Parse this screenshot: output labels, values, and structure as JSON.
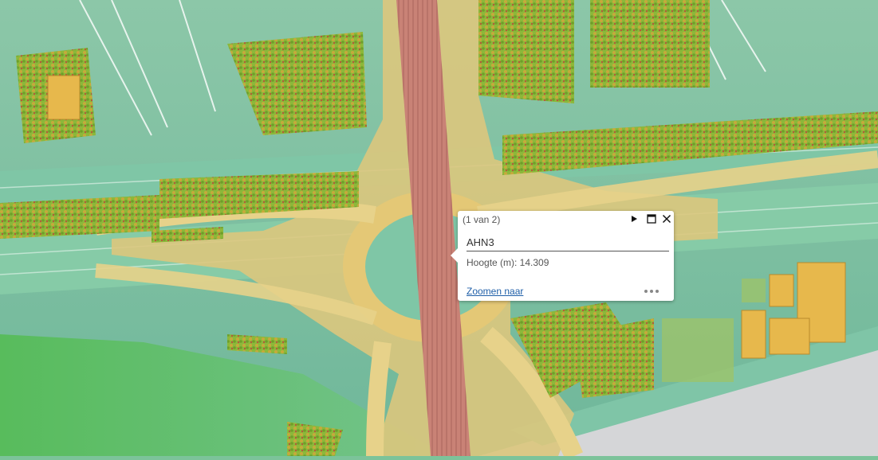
{
  "popup": {
    "pager": "(1 van 2)",
    "title": "AHN3",
    "attribute_label": "Hoogte (m):",
    "attribute_value": "14.309",
    "attribute_line": "Hoogte (m): 14.309",
    "zoom_link": "Zoomen naar",
    "icons": {
      "next": "play-right-icon",
      "maximize": "maximize-icon",
      "close": "close-icon",
      "more": "ellipsis-icon"
    }
  },
  "map": {
    "layer": "AHN3",
    "colors": {
      "low": "#2e9e63",
      "mid_low": "#78c79d",
      "mid": "#e9cf7a",
      "high": "#c97b73",
      "trees": "#b8a238",
      "buildings": "#e5b74d"
    }
  }
}
